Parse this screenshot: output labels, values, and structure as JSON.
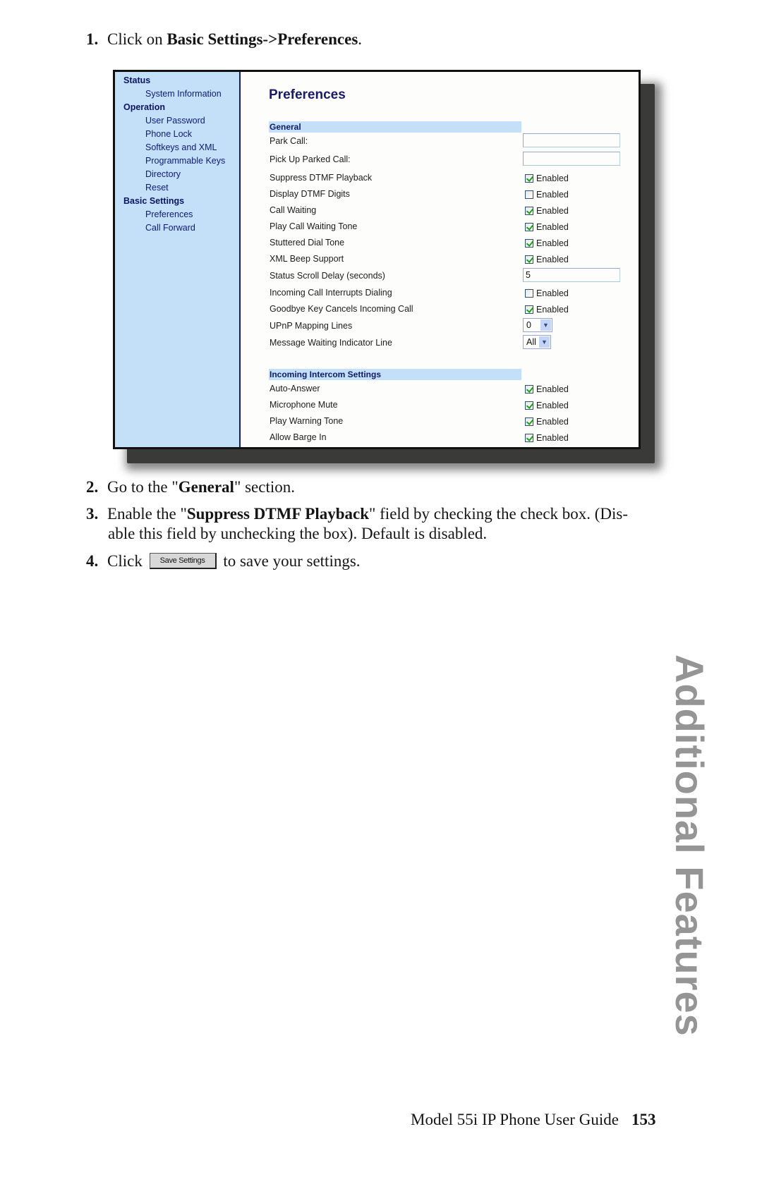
{
  "steps": {
    "step1": {
      "num": "1.",
      "pre": "Click on ",
      "bold": "Basic Settings->Preferences",
      "post": "."
    },
    "step2": {
      "num": "2.",
      "pre": "Go to the \"",
      "bold": "General",
      "post": "\" section."
    },
    "step3": {
      "num": "3.",
      "pre": "Enable the \"",
      "bold": "Suppress DTMF Playback",
      "post": "\" field by checking the check box. (Dis-",
      "cont": "able this field by unchecking the box). Default is disabled."
    },
    "step4": {
      "num": "4.",
      "pre": "Click",
      "button": "Save Settings",
      "post": "to save your settings."
    }
  },
  "screenshot": {
    "sidebar": [
      {
        "type": "head",
        "label": "Status"
      },
      {
        "type": "item",
        "label": "System Information"
      },
      {
        "type": "head",
        "label": "Operation"
      },
      {
        "type": "item",
        "label": "User Password"
      },
      {
        "type": "item",
        "label": "Phone Lock"
      },
      {
        "type": "item",
        "label": "Softkeys and XML"
      },
      {
        "type": "item",
        "label": "Programmable Keys"
      },
      {
        "type": "item",
        "label": "Directory"
      },
      {
        "type": "item",
        "label": "Reset"
      },
      {
        "type": "head",
        "label": "Basic Settings"
      },
      {
        "type": "item",
        "label": "Preferences"
      },
      {
        "type": "item",
        "label": "Call Forward"
      }
    ],
    "title": "Preferences",
    "sections": {
      "general": "General",
      "intercom": "Incoming Intercom Settings"
    },
    "enabled_label": "Enabled",
    "general_rows": [
      {
        "label": "Park Call:",
        "control": "text",
        "value": ""
      },
      {
        "label": "Pick Up Parked Call:",
        "control": "text",
        "value": ""
      },
      {
        "label": "Suppress DTMF Playback",
        "control": "checkbox",
        "checked": true
      },
      {
        "label": "Display DTMF Digits",
        "control": "checkbox",
        "checked": false
      },
      {
        "label": "Call Waiting",
        "control": "checkbox",
        "checked": true
      },
      {
        "label": "Play Call Waiting Tone",
        "control": "checkbox",
        "checked": true
      },
      {
        "label": "Stuttered Dial Tone",
        "control": "checkbox",
        "checked": true
      },
      {
        "label": "XML Beep Support",
        "control": "checkbox",
        "checked": true
      },
      {
        "label": "Status Scroll Delay (seconds)",
        "control": "text",
        "value": "5"
      },
      {
        "label": "Incoming Call Interrupts Dialing",
        "control": "checkbox",
        "checked": false
      },
      {
        "label": "Goodbye Key Cancels Incoming Call",
        "control": "checkbox",
        "checked": true
      },
      {
        "label": "UPnP Mapping Lines",
        "control": "select",
        "value": "0"
      },
      {
        "label": "Message Waiting Indicator Line",
        "control": "select",
        "value": "All"
      }
    ],
    "intercom_rows": [
      {
        "label": "Auto-Answer",
        "control": "checkbox",
        "checked": true
      },
      {
        "label": "Microphone Mute",
        "control": "checkbox",
        "checked": true
      },
      {
        "label": "Play Warning Tone",
        "control": "checkbox",
        "checked": true
      },
      {
        "label": "Allow Barge In",
        "control": "checkbox",
        "checked": true
      }
    ]
  },
  "side_tab": "Additional Features",
  "footer": {
    "title": "Model 55i IP Phone User Guide",
    "page": "153"
  }
}
